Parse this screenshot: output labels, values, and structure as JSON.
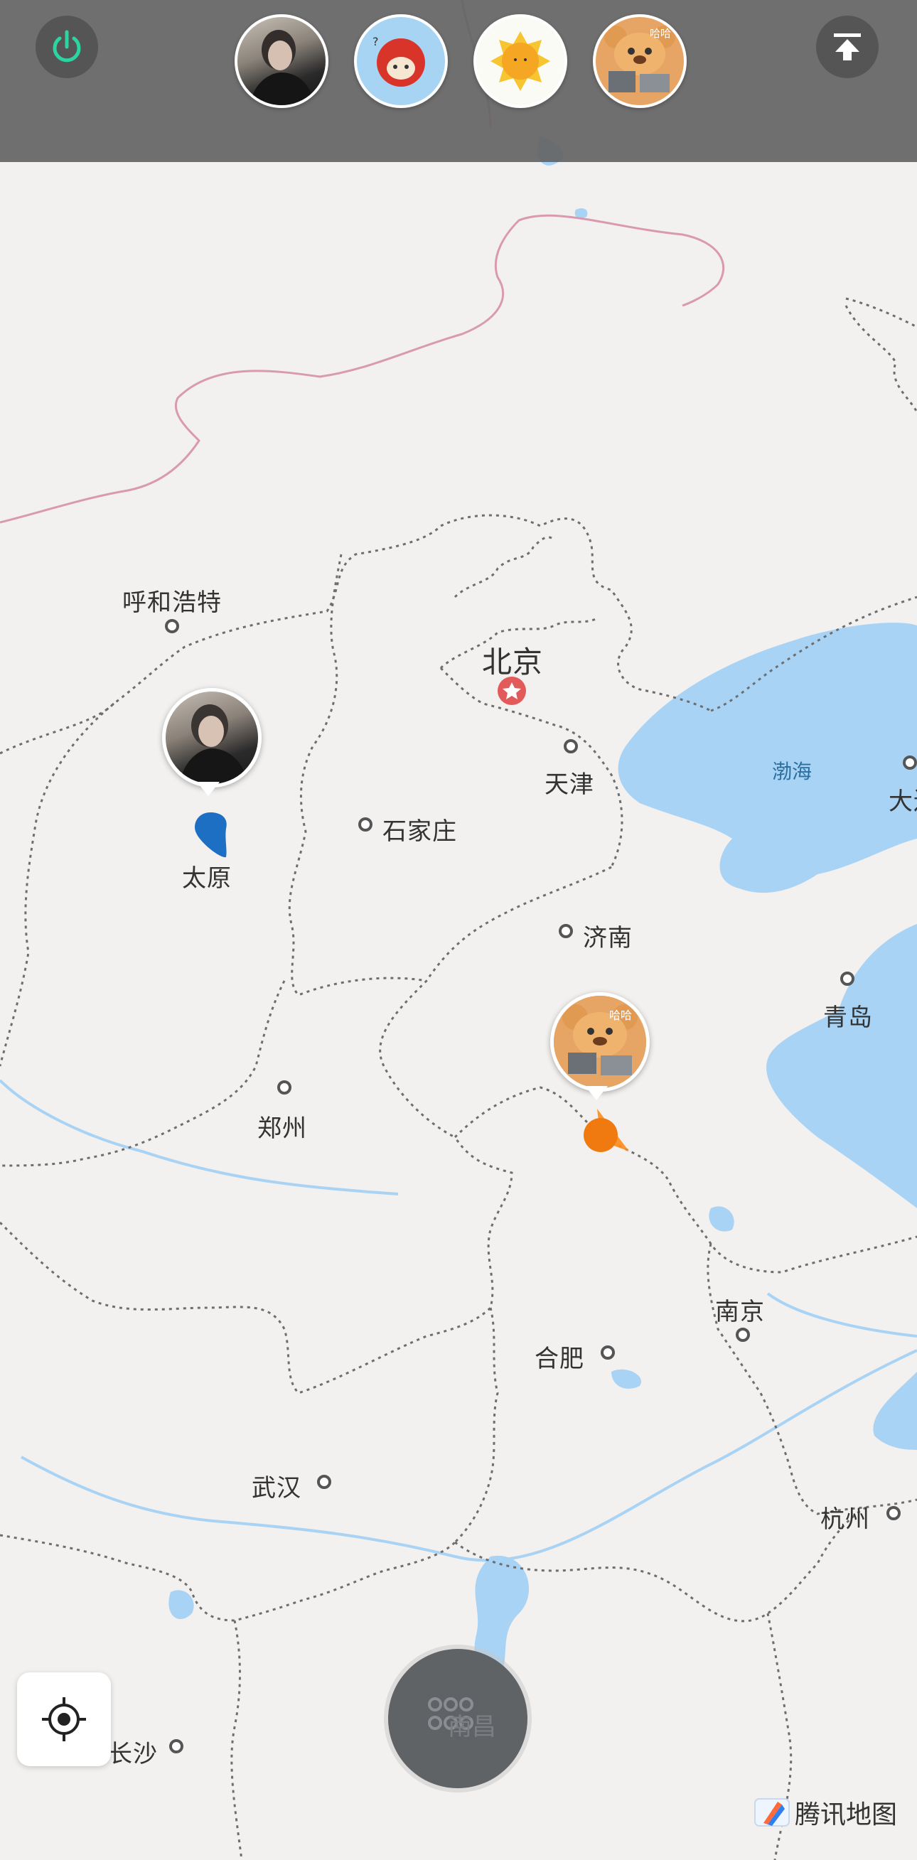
{
  "topbar": {
    "power_icon": "power-icon",
    "upload_icon": "upload-to-top-icon",
    "avatars": [
      {
        "name": "avatar-photo-person"
      },
      {
        "name": "avatar-red-cartoon"
      },
      {
        "name": "avatar-sun"
      },
      {
        "name": "avatar-bear-cartoon",
        "caption": "哈哈"
      }
    ]
  },
  "map": {
    "cities": {
      "hohhot": "呼和浩特",
      "beijing": "北京",
      "tianjin": "天津",
      "shijiazhuang": "石家庄",
      "taiyuan": "太原",
      "jinan": "济南",
      "qingdao": "青岛",
      "zhengzhou": "郑州",
      "nanjing": "南京",
      "hefei": "合肥",
      "wuhan": "武汉",
      "hangzhou": "杭州",
      "changsha": "长沙",
      "dalian": "大连"
    },
    "seas": {
      "bohai": "渤海"
    },
    "colors": {
      "land": "#f2f1ef",
      "water": "#a9d3f5",
      "border": "#6e6e6e",
      "national_border": "#d99ab0",
      "accent": "#2bd4a0"
    }
  },
  "markers": {
    "person_pin": {
      "name": "user-location-avatar-taiyuan"
    },
    "bear_pin": {
      "name": "user-location-avatar-bear",
      "caption": "哈哈"
    }
  },
  "controls": {
    "locate_icon": "crosshair-icon",
    "menu_icon": "grid-icon",
    "menu_text": "南昌"
  },
  "brand": {
    "text": "腾讯地图"
  }
}
